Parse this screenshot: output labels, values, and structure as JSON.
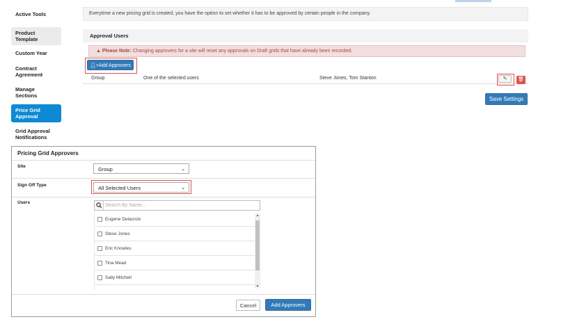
{
  "sidebar": {
    "items": [
      {
        "label": "Active Tools"
      },
      {
        "label": "Product Template"
      },
      {
        "label": "Custom Year"
      },
      {
        "label": "Contract Agreement"
      },
      {
        "label": "Manage Sections"
      },
      {
        "label": "Price Grid Approval"
      },
      {
        "label": "Grid Approval Notifications"
      }
    ]
  },
  "main": {
    "description": "Everytime a new pricing grid is created, you have the option to set whether it has to be approved by certain people in the company.",
    "section_title": "Approval Users",
    "alert_prefix": "Please Note:",
    "alert_text": "Changing approvers for a site will reset any approvals on Draft grids that have already been recorded.",
    "add_approvers_label": "Add Approvers",
    "row": {
      "site": "Group",
      "rule": "One of the selected users",
      "users": "Steve Jones, Tom Stanton"
    },
    "save_label": "Save Settings"
  },
  "modal": {
    "title": "Pricing Grid Approvers",
    "site_label": "Site",
    "site_value": "Group",
    "signoff_label": "Sign Off Type",
    "signoff_value": "All Selected Users",
    "users_label": "Users",
    "search_placeholder": "Search By Name...",
    "users": [
      "Eugene Delacroix",
      "Steve Jones",
      "Eric Knowles",
      "Tina Mead",
      "Sally Mitchell"
    ],
    "cancel_label": "Cancel",
    "submit_label": "Add Approvers"
  },
  "colors": {
    "primary": "#337ab7",
    "active_nav": "#0e89d4",
    "danger": "#d9534f",
    "alert_bg": "#f2dede",
    "alert_text": "#a94442"
  }
}
